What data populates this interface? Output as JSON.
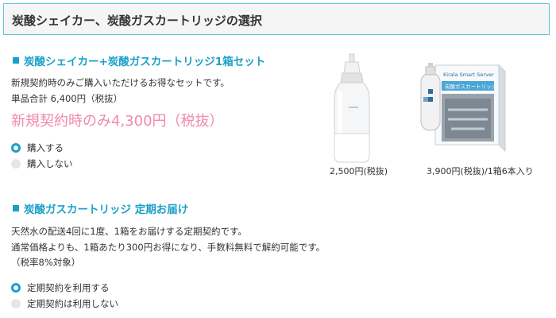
{
  "header": {
    "title": "炭酸シェイカー、炭酸ガスカートリッジの選択"
  },
  "set_section": {
    "title": "炭酸シェイカー+炭酸ガスカートリッジ1箱セット",
    "desc": "新規契約時のみご購入いただけるお得なセットです。",
    "total": "単品合計 6,400円（税抜）",
    "price": "新規契約時のみ4,300円（税抜）",
    "options": [
      {
        "label": "購入する",
        "selected": true
      },
      {
        "label": "購入しない",
        "selected": false
      }
    ]
  },
  "products": [
    {
      "icon": "shaker-bottle-icon",
      "caption": "2,500円(税抜)"
    },
    {
      "icon": "gas-cartridge-box-icon",
      "caption": "3,900円(税抜)/1箱6本入り",
      "box_brand": "Kirala Smart Server",
      "box_label": "炭酸ガスカートリッジ"
    }
  ],
  "subscription_section": {
    "title": "炭酸ガスカートリッジ 定期お届け",
    "line1": "天然水の配送4回に1度、1箱をお届けする定期契約です。",
    "line2": "通常価格よりも、1箱あたり300円お得になり、手数料無料で解約可能です。",
    "line3": "（税率8%対象）",
    "options": [
      {
        "label": "定期契約を利用する",
        "selected": true
      },
      {
        "label": "定期契約は利用しない",
        "selected": false
      }
    ]
  },
  "colors": {
    "accent": "#1aa0c8",
    "price_pink": "#f28aa9",
    "header_border": "#5bc6d9"
  }
}
